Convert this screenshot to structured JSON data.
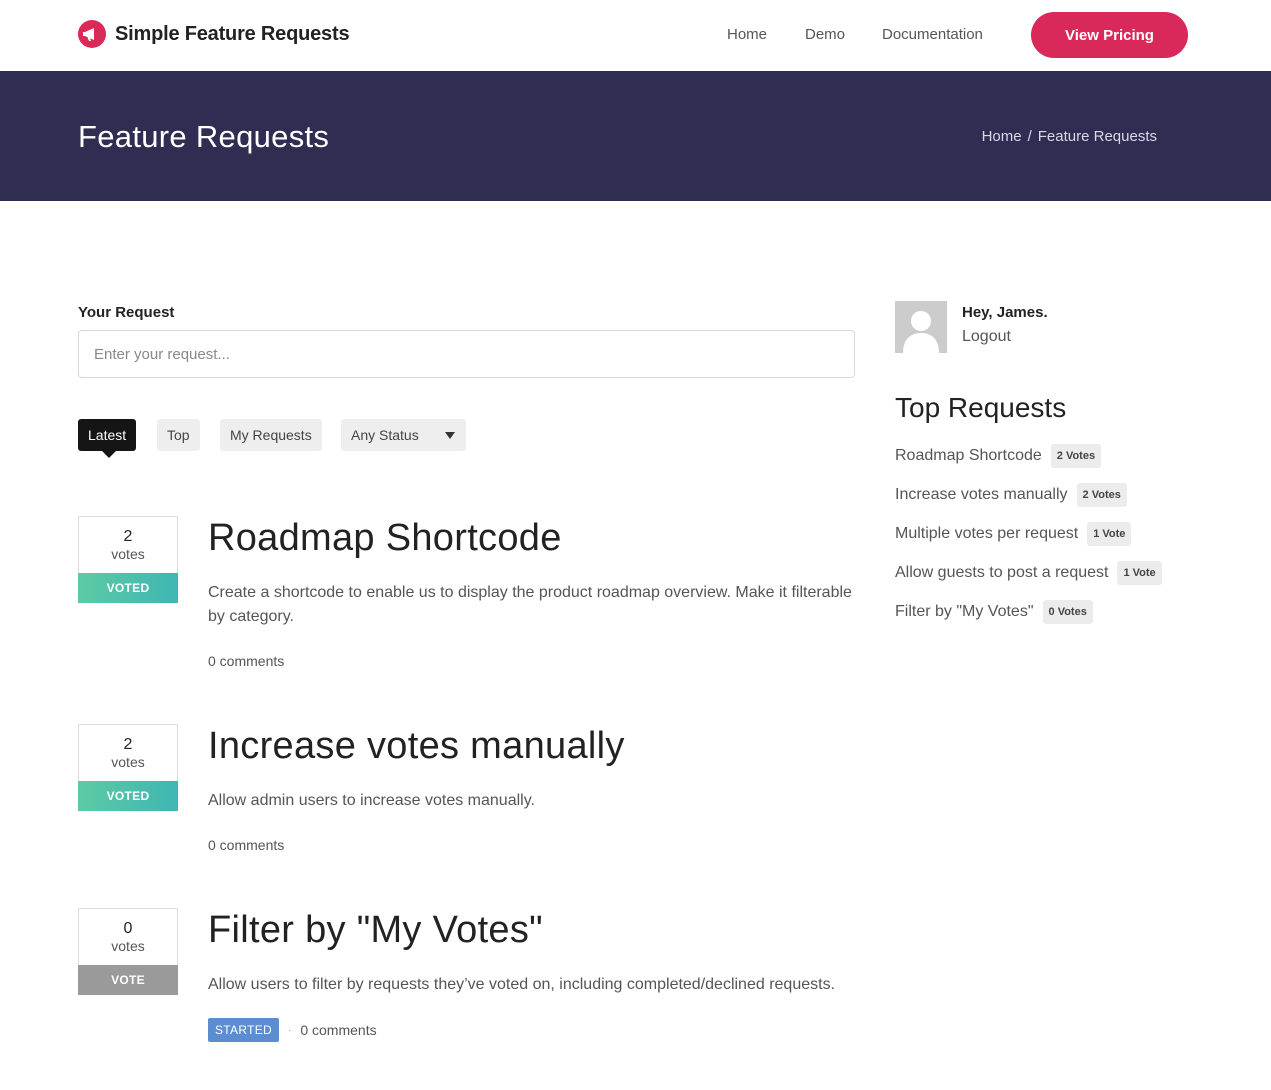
{
  "header": {
    "brand": "Simple Feature Requests",
    "nav": [
      "Home",
      "Demo",
      "Documentation"
    ],
    "cta": "View Pricing"
  },
  "banner": {
    "title": "Feature Requests",
    "breadcrumb": [
      "Home",
      "/",
      "Feature Requests"
    ]
  },
  "form": {
    "label": "Your Request",
    "placeholder": "Enter your request..."
  },
  "filters": {
    "tabs": [
      "Latest",
      "Top",
      "My Requests"
    ],
    "status_selected": "Any Status"
  },
  "requests": [
    {
      "votes": "2",
      "votes_label": "votes",
      "button": "VOTED",
      "title": "Roadmap Shortcode",
      "description": "Create a shortcode to enable us to display the product roadmap overview. Make it filterable by category.",
      "comments": "0 comments"
    },
    {
      "votes": "2",
      "votes_label": "votes",
      "button": "VOTED",
      "title": "Increase votes manually",
      "description": "Allow admin users to increase votes manually.",
      "comments": "0 comments"
    },
    {
      "votes": "0",
      "votes_label": "votes",
      "button": "VOTE",
      "title": "Filter by \"My Votes\"",
      "description": "Allow users to filter by requests they’ve voted on, including completed/declined requests.",
      "status": "STARTED",
      "separator": "·",
      "comments": "0 comments"
    }
  ],
  "sidebar": {
    "greeting": "Hey, James.",
    "logout": "Logout",
    "top_title": "Top Requests",
    "top_requests": [
      {
        "label": "Roadmap Shortcode",
        "badge": "2 Votes"
      },
      {
        "label": "Increase votes manually",
        "badge": "2 Votes"
      },
      {
        "label": "Multiple votes per request",
        "badge": "1 Vote"
      },
      {
        "label": "Allow guests to post a request",
        "badge": "1 Vote"
      },
      {
        "label": "Filter by \"My Votes\"",
        "badge": "0 Votes"
      }
    ]
  },
  "colors": {
    "brand": "#d9285a",
    "banner": "#2f2d51",
    "voted": "#4dc1ac",
    "vote": "#9a9a9a",
    "started": "#5b8dd1"
  },
  "icons": [
    "megaphone-icon",
    "chevron-down-icon",
    "user-avatar-icon"
  ]
}
